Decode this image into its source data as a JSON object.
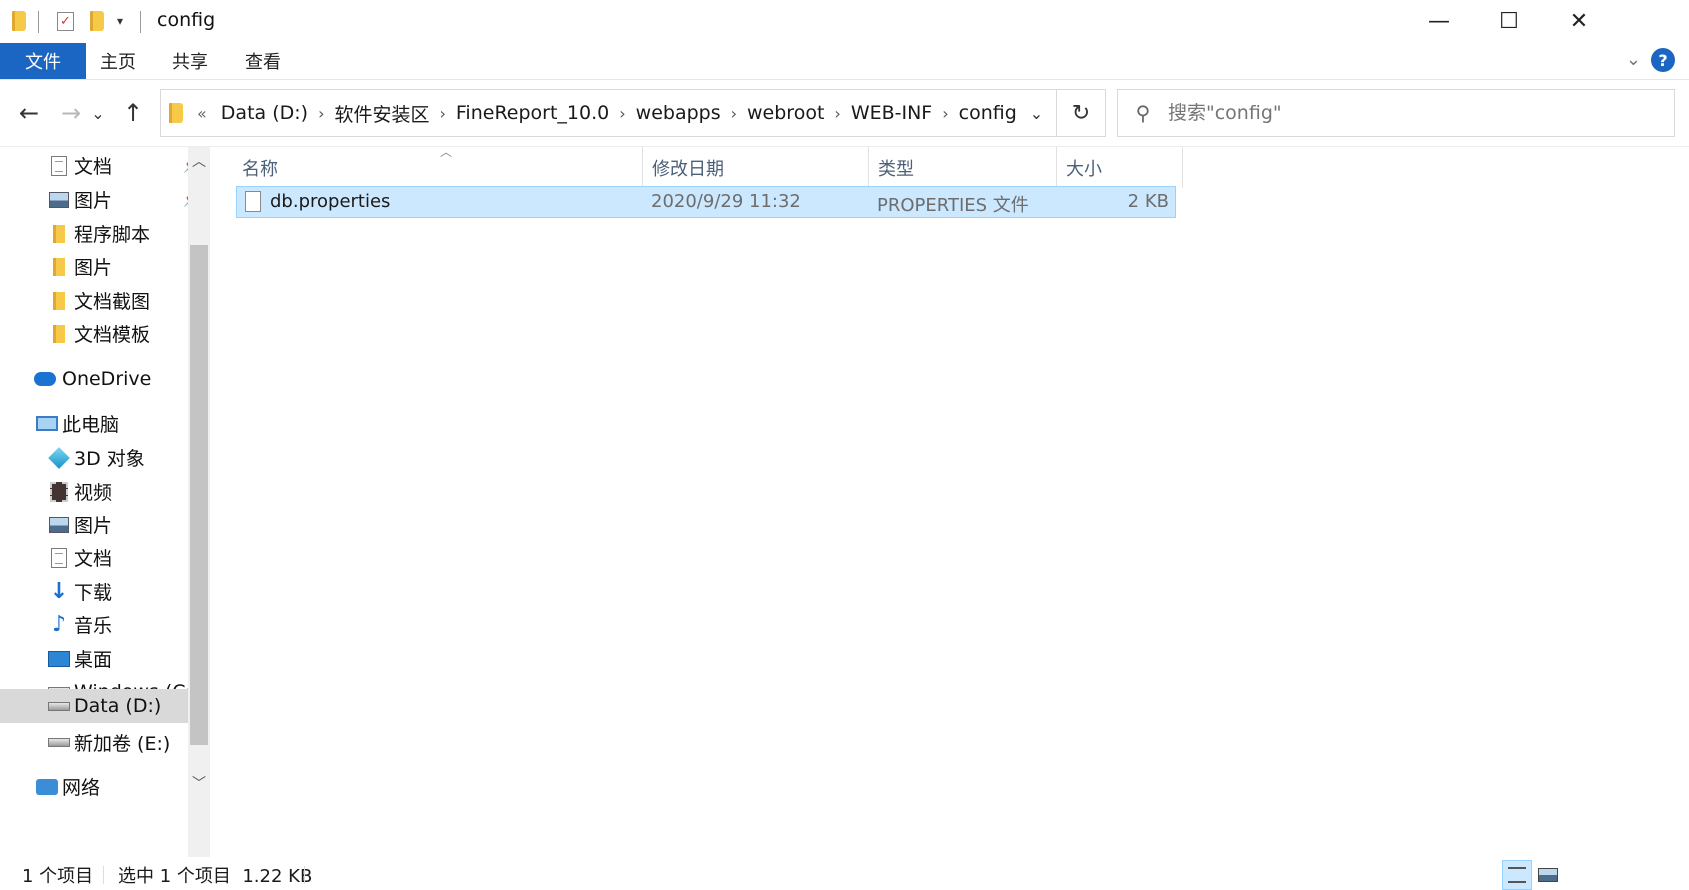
{
  "window": {
    "title": "config",
    "minimize": "—",
    "maximize": "☐",
    "close": "✕"
  },
  "ribbon": {
    "tabs": [
      "文件",
      "主页",
      "共享",
      "查看"
    ],
    "help": "?"
  },
  "nav": {
    "back": "←",
    "forward": "→",
    "recent": "⌄",
    "up": "↑",
    "overflow": "«",
    "breadcrumbs": [
      "Data (D:)",
      "软件安装区",
      "FineReport_10.0",
      "webapps",
      "webroot",
      "WEB-INF",
      "config"
    ],
    "refresh": "↻"
  },
  "search": {
    "placeholder": "搜索\"config\""
  },
  "sidebar": {
    "items": [
      {
        "label": "文档",
        "icon": "document-icon",
        "pinned": true
      },
      {
        "label": "图片",
        "icon": "pictures-icon",
        "pinned": true
      },
      {
        "label": "程序脚本",
        "icon": "folder-icon"
      },
      {
        "label": "图片",
        "icon": "folder-icon"
      },
      {
        "label": "文档截图",
        "icon": "folder-icon"
      },
      {
        "label": "文档模板",
        "icon": "folder-icon"
      },
      {
        "label": "OneDrive",
        "icon": "onedrive-icon"
      },
      {
        "label": "此电脑",
        "icon": "this-pc-icon"
      },
      {
        "label": "3D 对象",
        "icon": "3d-objects-icon"
      },
      {
        "label": "视频",
        "icon": "videos-icon"
      },
      {
        "label": "图片",
        "icon": "pictures-icon"
      },
      {
        "label": "文档",
        "icon": "document-icon"
      },
      {
        "label": "下载",
        "icon": "download-icon"
      },
      {
        "label": "音乐",
        "icon": "music-icon"
      },
      {
        "label": "桌面",
        "icon": "desktop-icon"
      },
      {
        "label": "Windows (C:)",
        "icon": "drive-icon"
      },
      {
        "label": "Data (D:)",
        "icon": "drive-icon",
        "selected": true
      },
      {
        "label": "新加卷 (E:)",
        "icon": "drive-icon"
      },
      {
        "label": "网络",
        "icon": "network-icon"
      }
    ]
  },
  "columns": [
    "名称",
    "修改日期",
    "类型",
    "大小"
  ],
  "files": [
    {
      "name": "db.properties",
      "modified": "2020/9/29 11:32",
      "type": "PROPERTIES 文件",
      "size": "2 KB",
      "selected": true
    }
  ],
  "status": {
    "count": "1 个项目",
    "selection": "选中 1 个项目  1.22 KB"
  },
  "colors": {
    "accent": "#1a66c2",
    "selection_bg": "#cce8ff",
    "selection_border": "#99d1ff"
  }
}
